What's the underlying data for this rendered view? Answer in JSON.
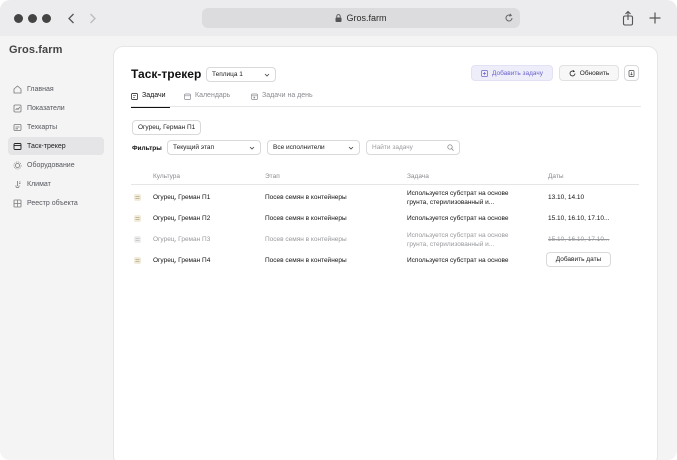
{
  "browser": {
    "url": "Gros.farm",
    "traffic_light_color": "#444444"
  },
  "app": {
    "logo": "Gros.farm"
  },
  "sidebar": {
    "items": [
      {
        "label": "Главная",
        "icon": "home-icon",
        "active": false
      },
      {
        "label": "Показатели",
        "icon": "indicators-icon",
        "active": false
      },
      {
        "label": "Техкарты",
        "icon": "techcard-icon",
        "active": false
      },
      {
        "label": "Таск-трекер",
        "icon": "task-tracker-icon",
        "active": true
      },
      {
        "label": "Оборудование",
        "icon": "equipment-icon",
        "active": false
      },
      {
        "label": "Климат",
        "icon": "climate-icon",
        "active": false
      },
      {
        "label": "Реестр объекта",
        "icon": "registry-icon",
        "active": false
      }
    ]
  },
  "header": {
    "title": "Таск-трекер",
    "greenhouse_select": "Теплица 1",
    "add_task_label": "Добавить задачу",
    "refresh_label": "Обновить",
    "accent_color": "#6d63c9"
  },
  "tabs": [
    {
      "label": "Задачи",
      "active": true
    },
    {
      "label": "Календарь",
      "active": false
    },
    {
      "label": "Задачи на день",
      "active": false
    }
  ],
  "chip": {
    "label": "Огурец, Герман П1"
  },
  "filters": {
    "label": "Фильтры",
    "stage": "Текущий этап",
    "assignee": "Все исполнители",
    "search_placeholder": "Найти задачу"
  },
  "table": {
    "columns": [
      "Культура",
      "Этап",
      "Задача",
      "Даты"
    ],
    "rows": [
      {
        "culture": "Огурец, Греман П1",
        "stage": "Посев семян в контейнеры",
        "task": "Используется субстрат на основе грунта, стерилизованный и...",
        "dates": "13.10, 14.10",
        "muted": false
      },
      {
        "culture": "Огурец, Греман П2",
        "stage": "Посев семян в контейнеры",
        "task": "Используется субстрат на основе",
        "dates": "15.10, 16.10, 17.10...",
        "muted": false
      },
      {
        "culture": "Огурец, Греман П3",
        "stage": "Посев семян в контейнеры",
        "task": "Используется субстрат на основе грунта, стерилизованный и...",
        "dates": "15.10, 16.10, 17.10...",
        "muted": true
      },
      {
        "culture": "Огурец, Греман П4",
        "stage": "Посев семян в контейнеры",
        "task": "Используется субстрат на основе",
        "dates_button": "Добавить даты",
        "muted": false
      }
    ]
  }
}
